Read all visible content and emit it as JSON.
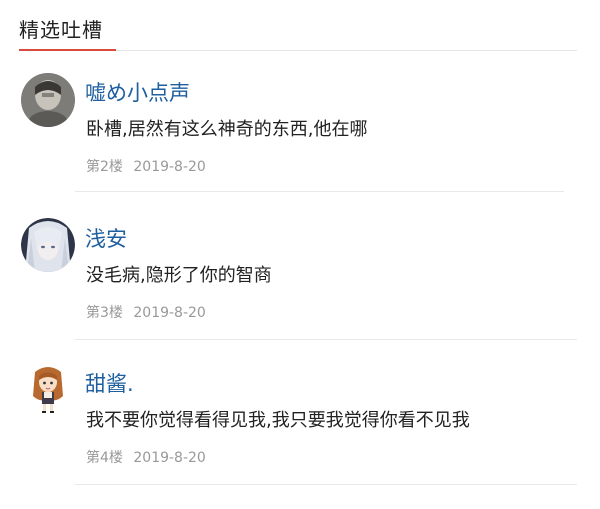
{
  "section": {
    "title": "精选吐槽"
  },
  "comments": [
    {
      "user": "嘘め小点声",
      "text": "卧槽,居然有这么神奇的东西,他在哪",
      "floor": "第2楼",
      "date": "2019-8-20",
      "avatar_icon": "avatar-dark-portrait-icon"
    },
    {
      "user": "浅安",
      "text": "没毛病,隐形了你的智商",
      "floor": "第3楼",
      "date": "2019-8-20",
      "avatar_icon": "avatar-anime-silver-hair-icon"
    },
    {
      "user": "甜酱.",
      "text": "我不要你觉得看得见我,我只要我觉得你看不见我",
      "floor": "第4楼",
      "date": "2019-8-20",
      "avatar_icon": "avatar-cartoon-girl-icon"
    }
  ],
  "colors": {
    "username": "#1f5f9f",
    "accent": "#d84a3c",
    "meta": "#999999"
  }
}
